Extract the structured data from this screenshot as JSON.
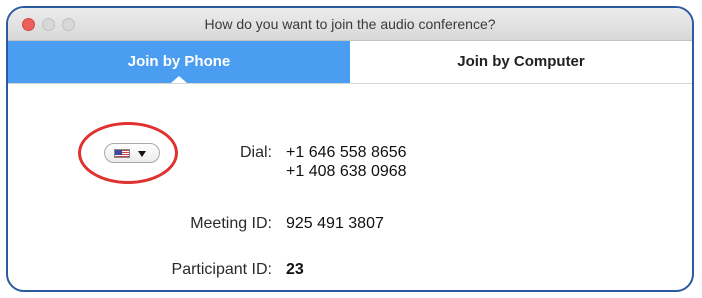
{
  "window": {
    "title": "How do you want to join the audio conference?"
  },
  "tabs": [
    {
      "label": "Join by Phone",
      "active": true
    },
    {
      "label": "Join by Computer",
      "active": false
    }
  ],
  "phone": {
    "country_icon": "us-flag-icon",
    "dial_label": "Dial:",
    "dial_numbers": [
      "+1 646 558 8656",
      "+1 408 638 0968"
    ],
    "meeting_id_label": "Meeting ID:",
    "meeting_id": "925 491 3807",
    "participant_id_label": "Participant ID:",
    "participant_id": "23"
  },
  "colors": {
    "active_tab": "#4a9df0",
    "highlight_circle": "#e0322e",
    "frame_border": "#2c5aa0"
  }
}
